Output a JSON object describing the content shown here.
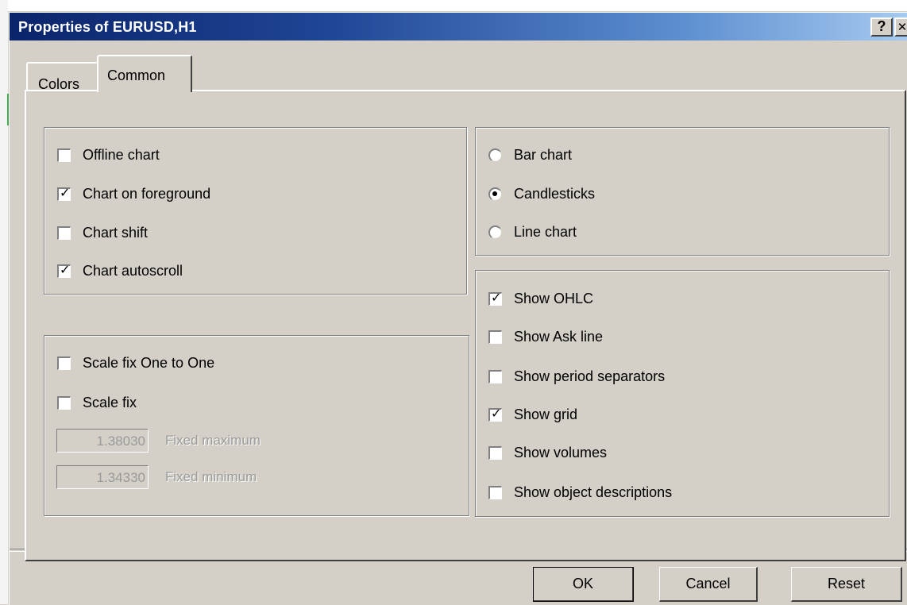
{
  "window": {
    "title": "Properties of EURUSD,H1",
    "help_button": "?",
    "close_button": "✕"
  },
  "tabs": [
    {
      "label": "Colors",
      "active": false
    },
    {
      "label": "Common",
      "active": true
    }
  ],
  "general_group": [
    {
      "label": "Offline chart",
      "checked": false
    },
    {
      "label": "Chart on foreground",
      "checked": true
    },
    {
      "label": "Chart shift",
      "checked": false
    },
    {
      "label": "Chart autoscroll",
      "checked": true
    }
  ],
  "chart_type_group": [
    {
      "label": "Bar chart",
      "selected": false
    },
    {
      "label": "Candlesticks",
      "selected": true
    },
    {
      "label": "Line chart",
      "selected": false
    }
  ],
  "scale_group": {
    "options": [
      {
        "label": "Scale fix One to One",
        "checked": false
      },
      {
        "label": "Scale fix",
        "checked": false
      }
    ],
    "fixed_maximum": {
      "value": "1.38030",
      "label": "Fixed maximum",
      "enabled": false
    },
    "fixed_minimum": {
      "value": "1.34330",
      "label": "Fixed minimum",
      "enabled": false
    }
  },
  "show_group": [
    {
      "label": "Show OHLC",
      "checked": true
    },
    {
      "label": "Show Ask line",
      "checked": false
    },
    {
      "label": "Show period separators",
      "checked": false
    },
    {
      "label": "Show grid",
      "checked": true
    },
    {
      "label": "Show volumes",
      "checked": false
    },
    {
      "label": "Show object descriptions",
      "checked": false
    }
  ],
  "buttons": {
    "ok": "OK",
    "cancel": "Cancel",
    "reset": "Reset"
  },
  "check_glyph": "✓"
}
